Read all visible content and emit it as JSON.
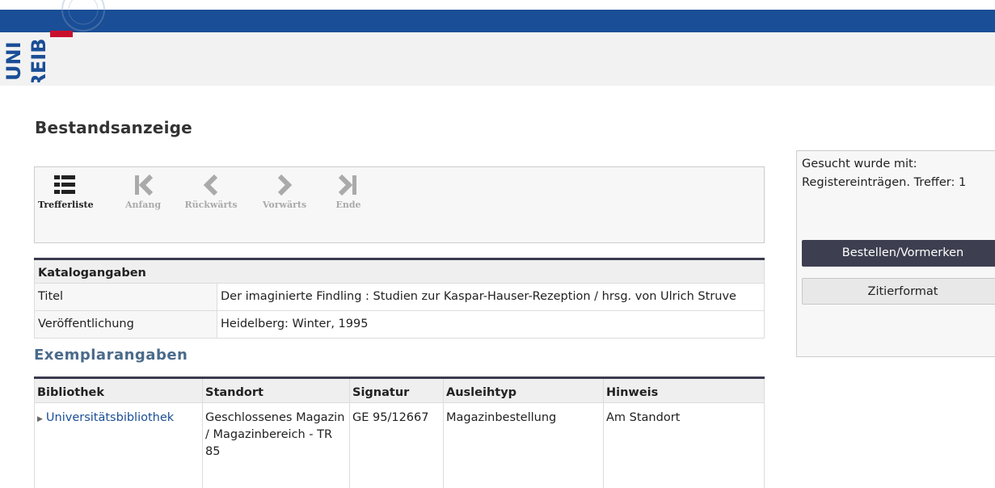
{
  "header": {
    "logo_line1": "UNI",
    "logo_line2": "FREIB",
    "brand_color": "#1a4e96",
    "accent_color": "#c8102e"
  },
  "page_title": "Bestandsanzeige",
  "nav": {
    "items": [
      {
        "label": "Trefferliste",
        "icon": "list-icon",
        "active": true
      },
      {
        "label": "Anfang",
        "icon": "first-page-icon",
        "active": false
      },
      {
        "label": "Rückwärts",
        "icon": "chevron-left-icon",
        "active": false
      },
      {
        "label": "Vorwärts",
        "icon": "chevron-right-icon",
        "active": false
      },
      {
        "label": "Ende",
        "icon": "last-page-icon",
        "active": false
      }
    ]
  },
  "katalog": {
    "heading": "Katalogangaben",
    "rows": [
      {
        "label": "Titel",
        "value": "Der imaginierte Findling : Studien zur Kaspar-Hauser-Rezeption / hrsg. von Ulrich Struve"
      },
      {
        "label": "Veröffentlichung",
        "value": "Heidelberg: Winter, 1995"
      }
    ]
  },
  "exemplar": {
    "heading": "Exemplarangaben",
    "columns": [
      "Bibliothek",
      "Standort",
      "Signatur",
      "Ausleihtyp",
      "Hinweis"
    ],
    "rows": [
      {
        "bibliothek": "Universitätsbibliothek",
        "standort": "Geschlossenes Magazin / Magazinbereich - TR 85",
        "signatur": "GE 95/12667",
        "ausleihtyp": "Magazinbestellung",
        "hinweis": "Am Standort"
      }
    ]
  },
  "sidebar": {
    "search_label": "Gesucht wurde mit:",
    "search_info": "Registereinträgen. Treffer: 1",
    "order_button": "Bestellen/Vormerken",
    "cite_button": "Zitierformat"
  }
}
